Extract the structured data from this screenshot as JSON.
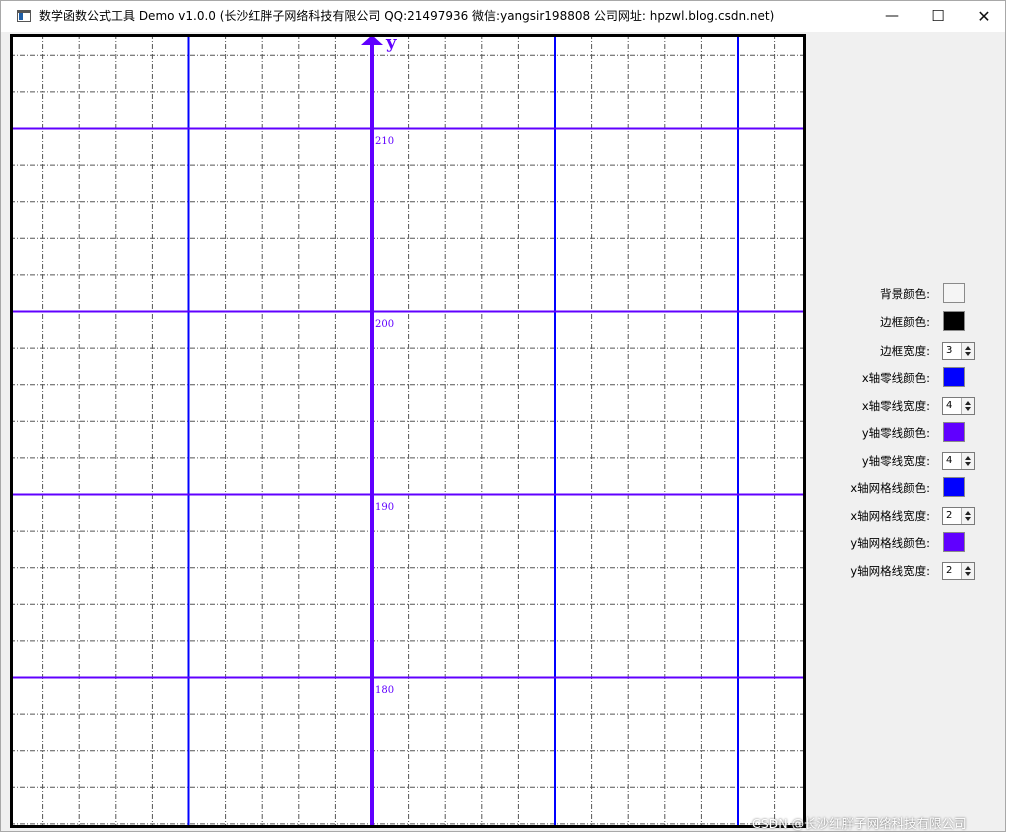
{
  "window": {
    "title": "数学函数公式工具 Demo v1.0.0 (长沙红胖子网络科技有限公司 QQ:21497936 微信:yangsir198808 公司网址: hpzwl.blog.csdn.net)",
    "min_glyph": "—",
    "max_glyph": "☐",
    "close_glyph": "✕"
  },
  "canvas": {
    "background": "#ffffff",
    "border_color": "#000000",
    "y_axis_label": "y",
    "y_tick_labels": [
      "210",
      "200",
      "190",
      "180"
    ],
    "x_zero_line_color": "#0000ff",
    "y_zero_line_color": "#6000ff",
    "x_grid_color": "#0000ff",
    "y_grid_color": "#6000ff",
    "minor_grid_color": "#555555"
  },
  "settings": {
    "rows": [
      {
        "label": "背景颜色:",
        "kind": "color",
        "value": "#f5f5f5"
      },
      {
        "label": "边框颜色:",
        "kind": "color",
        "value": "#000000"
      },
      {
        "label": "边框宽度:",
        "kind": "spin",
        "value": "3"
      },
      {
        "label": "x轴零线颜色:",
        "kind": "color",
        "value": "#0000ff"
      },
      {
        "label": "x轴零线宽度:",
        "kind": "spin",
        "value": "4"
      },
      {
        "label": "y轴零线颜色:",
        "kind": "color",
        "value": "#6000ff"
      },
      {
        "label": "y轴零线宽度:",
        "kind": "spin",
        "value": "4"
      },
      {
        "label": "x轴网格线颜色:",
        "kind": "color",
        "value": "#0000ff"
      },
      {
        "label": "x轴网格线宽度:",
        "kind": "spin",
        "value": "2"
      },
      {
        "label": "y轴网格线颜色:",
        "kind": "color",
        "value": "#6000ff"
      },
      {
        "label": "y轴网格线宽度:",
        "kind": "spin",
        "value": "2"
      }
    ]
  },
  "watermark": "CSDN @长沙红胖子网络科技有限公司"
}
